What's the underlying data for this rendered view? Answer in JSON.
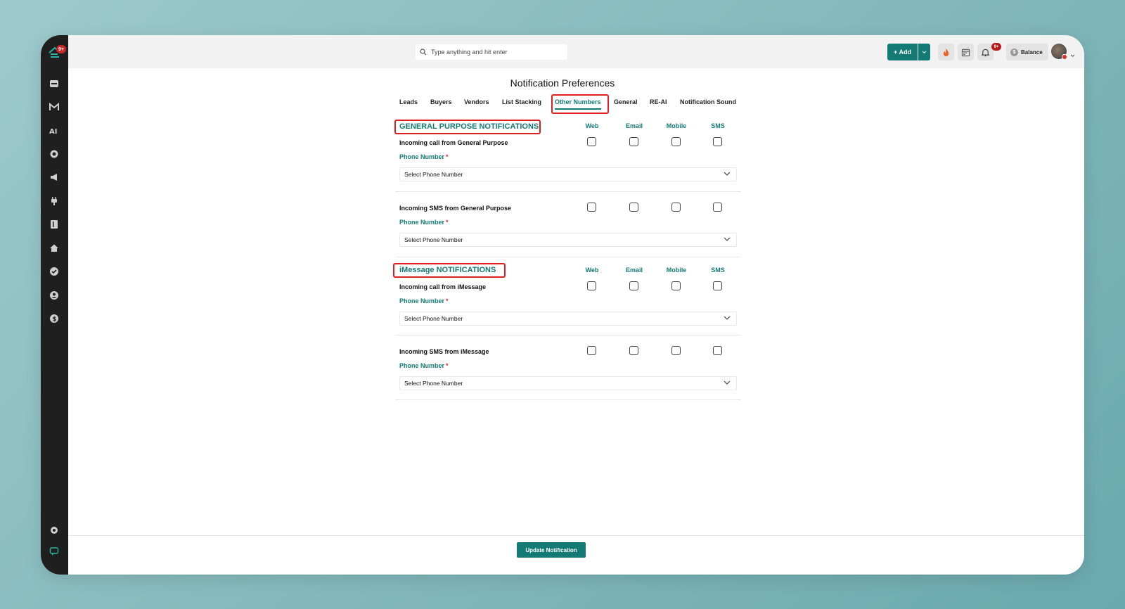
{
  "colors": {
    "accent": "#137a75",
    "highlight": "#e02020",
    "sidebar": "#1f1f1f",
    "badge": "#b71c1c"
  },
  "sidebar": {
    "logo_badge": "9+",
    "icons": [
      "inbox-icon",
      "gmail-icon",
      "ai-icon",
      "target-icon",
      "megaphone-icon",
      "plug-icon",
      "book-icon",
      "home-icon",
      "check-circle-icon",
      "user-circle-icon",
      "dollar-icon",
      "settings-icon",
      "chat-icon"
    ]
  },
  "topbar": {
    "search_placeholder": "Type anything and hit enter",
    "add_label": "+ Add",
    "notif_badge": "9+",
    "balance_label": "Balance",
    "balance_coin": "$"
  },
  "page": {
    "title": "Notification Preferences",
    "tabs": [
      "Leads",
      "Buyers",
      "Vendors",
      "List Stacking",
      "Other Numbers",
      "General",
      "RE-AI",
      "Notification Sound"
    ],
    "active_tab": "Other Numbers"
  },
  "columns": [
    "Web",
    "Email",
    "Mobile",
    "SMS"
  ],
  "sections": [
    {
      "title": "GENERAL PURPOSE NOTIFICATIONS",
      "rows": [
        {
          "label": "Incoming call from General Purpose",
          "phone_label": "Phone Number",
          "required": "*",
          "select_placeholder": "Select Phone Number"
        },
        {
          "label": "Incoming SMS from General Purpose",
          "phone_label": "Phone Number",
          "required": "*",
          "select_placeholder": "Select Phone Number"
        }
      ]
    },
    {
      "title": "iMessage NOTIFICATIONS",
      "rows": [
        {
          "label": "Incoming call from iMessage",
          "phone_label": "Phone Number",
          "required": "*",
          "select_placeholder": "Select Phone Number"
        },
        {
          "label": "Incoming SMS from iMessage",
          "phone_label": "Phone Number",
          "required": "*",
          "select_placeholder": "Select Phone Number"
        }
      ]
    }
  ],
  "footer": {
    "update_label": "Update Notification"
  }
}
